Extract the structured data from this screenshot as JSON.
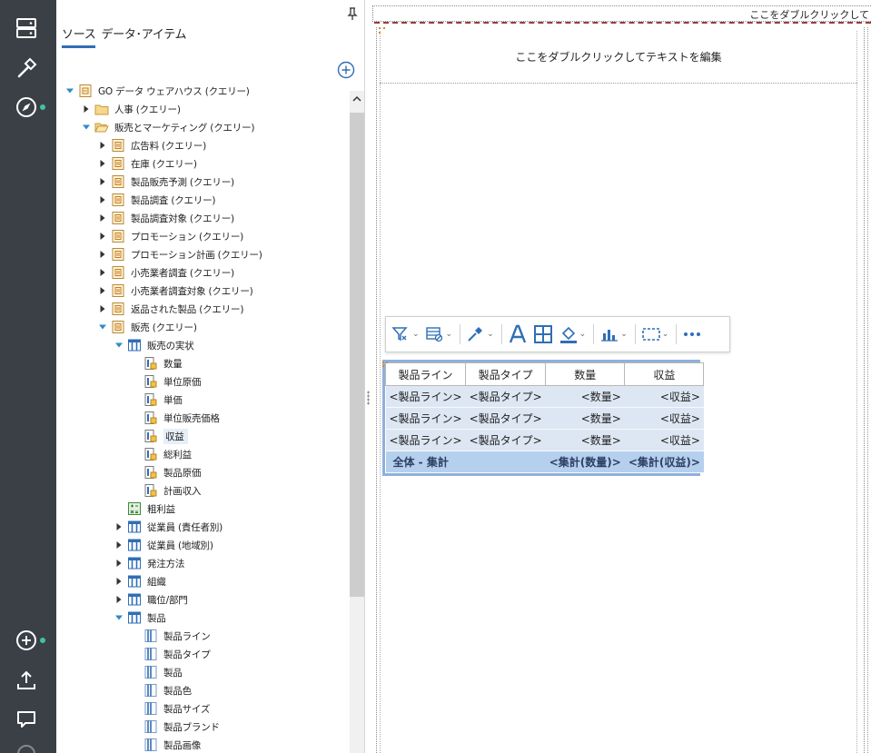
{
  "source_panel": {
    "tabs": [
      {
        "label": "ソース",
        "active": true
      },
      {
        "label": "データ･アイテム",
        "active": false
      }
    ]
  },
  "tree": [
    {
      "label": "GO データ ウェアハウス (クエリー)",
      "icon": "package-query-icon",
      "twisty": "expanded",
      "level": 0
    },
    {
      "label": "人事 (クエリー)",
      "icon": "folder-icon",
      "twisty": "collapsed",
      "level": 1
    },
    {
      "label": "販売とマーケティング (クエリー)",
      "icon": "folder-open-icon",
      "twisty": "expanded",
      "level": 1
    },
    {
      "label": "広告料 (クエリー)",
      "icon": "query-subject-icon",
      "twisty": "collapsed",
      "level": 2
    },
    {
      "label": "在庫 (クエリー)",
      "icon": "query-subject-icon",
      "twisty": "collapsed",
      "level": 2
    },
    {
      "label": "製品販売予測 (クエリー)",
      "icon": "query-subject-icon",
      "twisty": "collapsed",
      "level": 2
    },
    {
      "label": "製品調査 (クエリー)",
      "icon": "query-subject-icon",
      "twisty": "collapsed",
      "level": 2
    },
    {
      "label": "製品調査対象 (クエリー)",
      "icon": "query-subject-icon",
      "twisty": "collapsed",
      "level": 2
    },
    {
      "label": "プロモーション (クエリー)",
      "icon": "query-subject-icon",
      "twisty": "collapsed",
      "level": 2
    },
    {
      "label": "プロモーション計画 (クエリー)",
      "icon": "query-subject-icon",
      "twisty": "collapsed",
      "level": 2
    },
    {
      "label": "小売業者調査 (クエリー)",
      "icon": "query-subject-icon",
      "twisty": "collapsed",
      "level": 2
    },
    {
      "label": "小売業者調査対象 (クエリー)",
      "icon": "query-subject-icon",
      "twisty": "collapsed",
      "level": 2
    },
    {
      "label": "返品された製品 (クエリー)",
      "icon": "query-subject-icon",
      "twisty": "collapsed",
      "level": 2
    },
    {
      "label": "販売 (クエリー)",
      "icon": "query-subject-icon",
      "twisty": "expanded",
      "level": 2
    },
    {
      "label": "販売の実状",
      "icon": "fact-table-icon",
      "twisty": "expanded",
      "level": 3
    },
    {
      "label": "数量",
      "icon": "measure-icon",
      "twisty": "none",
      "level": 4
    },
    {
      "label": "単位原価",
      "icon": "measure-icon",
      "twisty": "none",
      "level": 4
    },
    {
      "label": "単価",
      "icon": "measure-icon",
      "twisty": "none",
      "level": 4
    },
    {
      "label": "単位販売価格",
      "icon": "measure-icon",
      "twisty": "none",
      "level": 4
    },
    {
      "label": "収益",
      "icon": "measure-icon",
      "twisty": "none",
      "level": 4,
      "selected": true
    },
    {
      "label": "総利益",
      "icon": "measure-icon",
      "twisty": "none",
      "level": 4
    },
    {
      "label": "製品原価",
      "icon": "measure-icon",
      "twisty": "none",
      "level": 4
    },
    {
      "label": "計画収入",
      "icon": "measure-icon",
      "twisty": "none",
      "level": 4
    },
    {
      "label": "粗利益",
      "icon": "calculation-icon",
      "twisty": "none",
      "level": 3
    },
    {
      "label": "従業員 (責任者別)",
      "icon": "dimension-table-icon",
      "twisty": "collapsed",
      "level": 3
    },
    {
      "label": "従業員 (地域別)",
      "icon": "dimension-table-icon",
      "twisty": "collapsed",
      "level": 3
    },
    {
      "label": "発注方法",
      "icon": "dimension-table-icon",
      "twisty": "collapsed",
      "level": 3
    },
    {
      "label": "組織",
      "icon": "dimension-table-icon",
      "twisty": "collapsed",
      "level": 3
    },
    {
      "label": "職位/部門",
      "icon": "dimension-table-icon",
      "twisty": "collapsed",
      "level": 3
    },
    {
      "label": "製品",
      "icon": "dimension-table-icon",
      "twisty": "expanded",
      "level": 3
    },
    {
      "label": "製品ライン",
      "icon": "attribute-icon",
      "twisty": "none",
      "level": 4
    },
    {
      "label": "製品タイプ",
      "icon": "attribute-icon",
      "twisty": "none",
      "level": 4
    },
    {
      "label": "製品",
      "icon": "attribute-icon",
      "twisty": "none",
      "level": 4
    },
    {
      "label": "製品色",
      "icon": "attribute-icon",
      "twisty": "none",
      "level": 4
    },
    {
      "label": "製品サイズ",
      "icon": "attribute-icon",
      "twisty": "none",
      "level": 4
    },
    {
      "label": "製品ブランド",
      "icon": "attribute-icon",
      "twisty": "none",
      "level": 4
    },
    {
      "label": "製品画像",
      "icon": "attribute-icon",
      "twisty": "none",
      "level": 4
    }
  ],
  "canvas": {
    "top_title": "ここをダブルクリックして",
    "header_text": "ここをダブルクリックしてテキストを編集"
  },
  "toolbar": {
    "buttons": [
      "filter-icon",
      "suppress-icon",
      "eyedropper-icon",
      "font-icon",
      "borders-icon",
      "fill-color-icon",
      "chart-icon",
      "select-ancestor-icon",
      "more-icon"
    ]
  },
  "list_report": {
    "columns": [
      "製品ライン",
      "製品タイプ",
      "数量",
      "収益"
    ],
    "rows": [
      [
        "<製品ライン>",
        "<製品タイプ>",
        "<数量>",
        "<収益>"
      ],
      [
        "<製品ライン>",
        "<製品タイプ>",
        "<数量>",
        "<収益>"
      ],
      [
        "<製品ライン>",
        "<製品タイプ>",
        "<数量>",
        "<収益>"
      ]
    ],
    "total_row": {
      "label": "全体  - 集計",
      "quantity": "<集計(数量)>",
      "revenue": "<集計(収益)>"
    }
  },
  "colors": {
    "rail": "#3b4047",
    "accent": "#2f6eb5",
    "status_dot": "#3fc4a2",
    "list_row": "#dde7f3",
    "list_total": "#b5d0ec"
  }
}
